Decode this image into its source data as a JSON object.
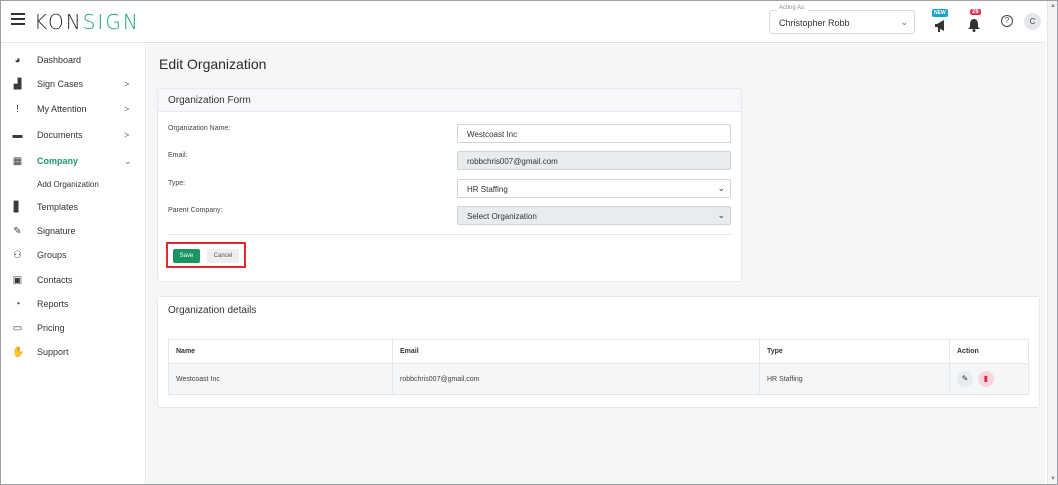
{
  "header": {
    "logo_left": "K",
    "logo_mid": "ON",
    "logo_accent": "SIGN",
    "acting_label": "Acting As:",
    "acting_value": "Christopher Robb",
    "new_badge": "NEW",
    "notification_count": "26",
    "help_glyph": "?",
    "avatar_initial": "C"
  },
  "sidebar": {
    "items": [
      {
        "label": "Dashboard",
        "icon": "dashboard-icon",
        "glyph": "◕",
        "arrow": ""
      },
      {
        "label": "Sign Cases",
        "icon": "briefcase-icon",
        "glyph": "▟",
        "arrow": ">"
      },
      {
        "label": "My Attention",
        "icon": "exclamation-icon",
        "glyph": "!",
        "arrow": ">"
      },
      {
        "label": "Documents",
        "icon": "folder-icon",
        "glyph": "▬",
        "arrow": ">"
      },
      {
        "label": "Company",
        "icon": "building-icon",
        "glyph": "▦",
        "arrow": "⌄"
      },
      {
        "label": "Templates",
        "icon": "templates-icon",
        "glyph": "▋",
        "arrow": ""
      },
      {
        "label": "Signature",
        "icon": "pen-icon",
        "glyph": "✎",
        "arrow": ""
      },
      {
        "label": "Groups",
        "icon": "users-icon",
        "glyph": "⚇",
        "arrow": ""
      },
      {
        "label": "Contacts",
        "icon": "contact-card-icon",
        "glyph": "▣",
        "arrow": ""
      },
      {
        "label": "Reports",
        "icon": "pie-chart-icon",
        "glyph": "◔",
        "arrow": ""
      },
      {
        "label": "Pricing",
        "icon": "money-icon",
        "glyph": "▭",
        "arrow": ""
      },
      {
        "label": "Support",
        "icon": "handshake-icon",
        "glyph": "✋",
        "arrow": ""
      }
    ],
    "sub_item": "Add Organization"
  },
  "main": {
    "page_title": "Edit Organization",
    "form": {
      "title": "Organization Form",
      "name_label": "Organization Name:",
      "name_value": "Westcoast Inc",
      "email_label": "Email:",
      "email_value": "robbchris007@gmail.com",
      "type_label": "Type:",
      "type_value": "HR Staffing",
      "parent_label": "Parent Company:",
      "parent_value": "Select Organization",
      "save_label": "Save",
      "cancel_label": "Cancel"
    },
    "details": {
      "title": "Organization details",
      "columns": [
        "Name",
        "Email",
        "Type",
        "Action"
      ],
      "rows": [
        {
          "name": "Westcoast Inc",
          "email": "robbchris007@gmail.com",
          "type": "HR Staffing"
        }
      ]
    }
  },
  "colors": {
    "accent": "#1fa37a",
    "save": "#199563",
    "highlight": "#e02b2b",
    "delete": "#d9304a"
  }
}
